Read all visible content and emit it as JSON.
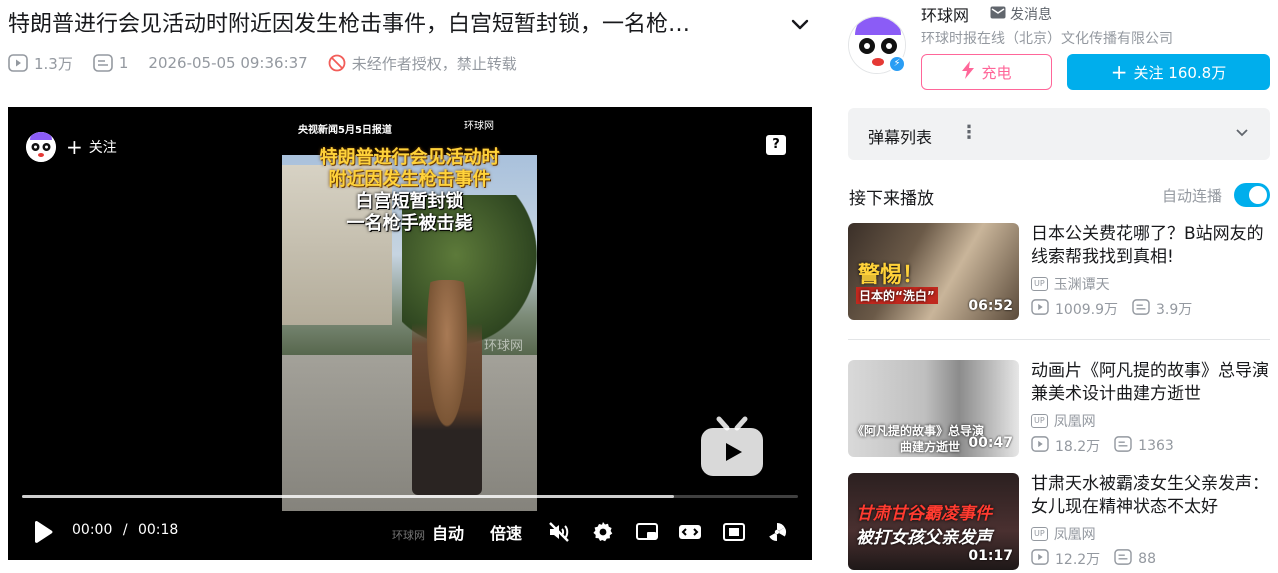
{
  "video": {
    "title": "特朗普进行会见活动时附近因发生枪击事件，白宫短暂封锁，一名枪…",
    "views": "1.3万",
    "danmaku_count": "1",
    "datetime": "2026-05-05 09:36:37",
    "copyright_notice": "未经作者授权，禁止转载"
  },
  "player": {
    "caption_line1": "特朗普进行会见活动时",
    "caption_line2": "附近因发生枪击事件",
    "caption_line3": "白宫短暂封锁",
    "caption_line4": "一名枪手被击毙",
    "top_text": "央视新闻5月5日报道",
    "watermark_top": "环球网",
    "watermark_mid": "环球网",
    "watermark_bottom": "环球网",
    "follow_label": "关注",
    "help_label": "?",
    "progress_fraction": 0.84,
    "time_current": "00:00",
    "time_separator": "/",
    "time_total": "00:18",
    "auto_label": "自动",
    "speed_label": "倍速"
  },
  "uploader": {
    "name": "环球网",
    "message_label": "发消息",
    "description": "环球时报在线（北京）文化传播有限公司",
    "charge_label": "充电",
    "follow_label": "关注 160.8万"
  },
  "danmaku_panel": {
    "label": "弹幕列表",
    "more": "⋮"
  },
  "recommend": {
    "heading": "接下来播放",
    "autoplay_label": "自动连播",
    "autoplay_on": true,
    "items": [
      {
        "title": "日本公关费花哪了？B站网友的线索帮我找到真相!",
        "uploader": "玉渊谭天",
        "views": "1009.9万",
        "danmaku": "3.9万",
        "duration": "06:52",
        "thumb_text1": "警惕！",
        "thumb_text2": "日本的“洗白”"
      },
      {
        "title": "动画片《阿凡提的故事》总导演兼美术设计曲建方逝世",
        "uploader": "凤凰网",
        "views": "18.2万",
        "danmaku": "1363",
        "duration": "00:47",
        "thumb_text1": "《阿凡提的故事》总导演",
        "thumb_text2": "曲建方逝世"
      },
      {
        "title": "甘肃天水被霸凌女生父亲发声：女儿现在精神状态不太好",
        "uploader": "凤凰网",
        "views": "12.2万",
        "danmaku": "88",
        "duration": "01:17",
        "thumb_text1": "甘肃甘谷霸凌事件",
        "thumb_text2": "被打女孩父亲发声"
      }
    ]
  },
  "colors": {
    "accent": "#00aeec",
    "charge": "#ff6699",
    "meta_gray": "#9499a0",
    "caption_yellow": "#ffd23a"
  }
}
